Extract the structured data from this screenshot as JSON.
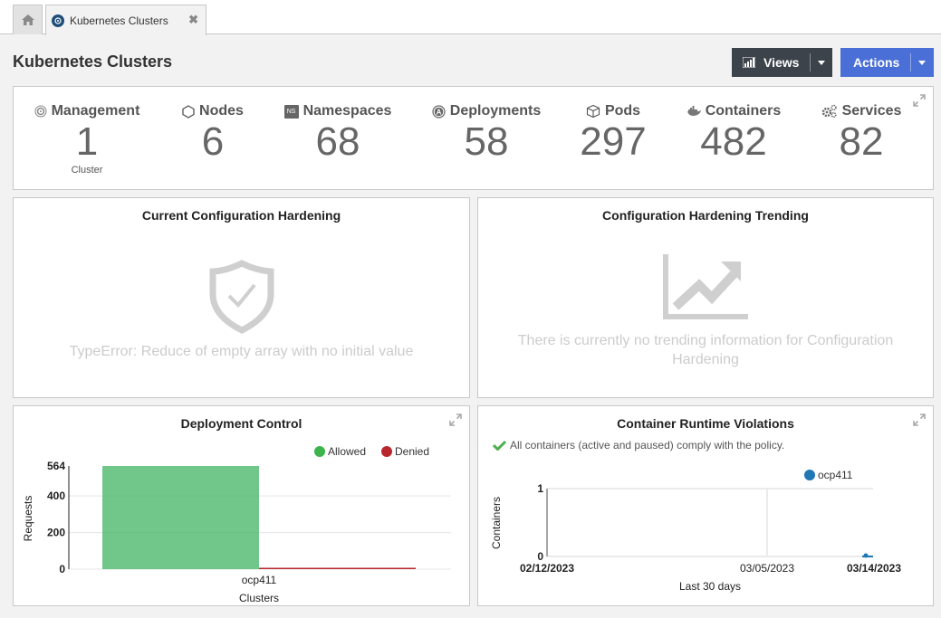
{
  "tabs": {
    "home_icon": "home-icon",
    "active_tab": {
      "label": "Kubernetes Clusters",
      "icon": "kubernetes-icon",
      "close_icon": "close-icon"
    }
  },
  "header": {
    "title": "Kubernetes Clusters",
    "views_button": {
      "label": "Views",
      "icon": "bar-chart-icon"
    },
    "actions_button": {
      "label": "Actions"
    }
  },
  "colors": {
    "views_bg": "#3d434b",
    "actions_bg": "#4a6fd6",
    "allowed": "#4cb96c",
    "denied": "#b9272e",
    "series_ocp411": "#1f77b4"
  },
  "stats": [
    {
      "label": "Management",
      "value": "1",
      "sub": "Cluster",
      "icon": "helm-icon"
    },
    {
      "label": "Nodes",
      "value": "6",
      "icon": "hexagon-icon"
    },
    {
      "label": "Namespaces",
      "value": "68",
      "icon": "namespace-icon",
      "icon_text": "NS"
    },
    {
      "label": "Deployments",
      "value": "58",
      "icon": "deployment-icon"
    },
    {
      "label": "Pods",
      "value": "297",
      "icon": "cube-icon"
    },
    {
      "label": "Containers",
      "value": "482",
      "icon": "docker-icon"
    },
    {
      "label": "Services",
      "value": "82",
      "icon": "cogs-icon"
    }
  ],
  "cards": {
    "current_hardening": {
      "title": "Current Configuration Hardening",
      "message": "TypeError: Reduce of empty array with no initial value"
    },
    "hardening_trending": {
      "title": "Configuration Hardening Trending",
      "message_line1": "There is currently no trending information for Configuration",
      "message_line2": "Hardening"
    },
    "deployment_control": {
      "title": "Deployment Control"
    },
    "runtime_violations": {
      "title": "Container Runtime Violations",
      "status": "All containers (active and paused) comply with the policy."
    }
  },
  "chart_data": [
    {
      "type": "bar",
      "title": "Deployment Control",
      "categories": [
        "ocp411"
      ],
      "series": [
        {
          "name": "Allowed",
          "values": [
            564
          ]
        },
        {
          "name": "Denied",
          "values": [
            0
          ]
        }
      ],
      "xlabel": "Clusters",
      "ylabel": "Requests",
      "yticks": [
        "0",
        "200",
        "400",
        "564"
      ],
      "ylim": [
        0,
        564
      ],
      "legend": "top-right",
      "grid": true
    },
    {
      "type": "line",
      "title": "Container Runtime Violations",
      "series": [
        {
          "name": "ocp411",
          "x": [
            "03/13/2023",
            "03/14/2023"
          ],
          "values": [
            0,
            0
          ]
        }
      ],
      "xlabel": "Last 30 days",
      "ylabel": "Containers",
      "xticks": [
        "02/12/2023",
        "03/05/2023",
        "03/14/2023"
      ],
      "yticks": [
        "0",
        "1"
      ],
      "ylim": [
        0,
        1
      ],
      "legend": "top-right",
      "grid": true
    }
  ]
}
